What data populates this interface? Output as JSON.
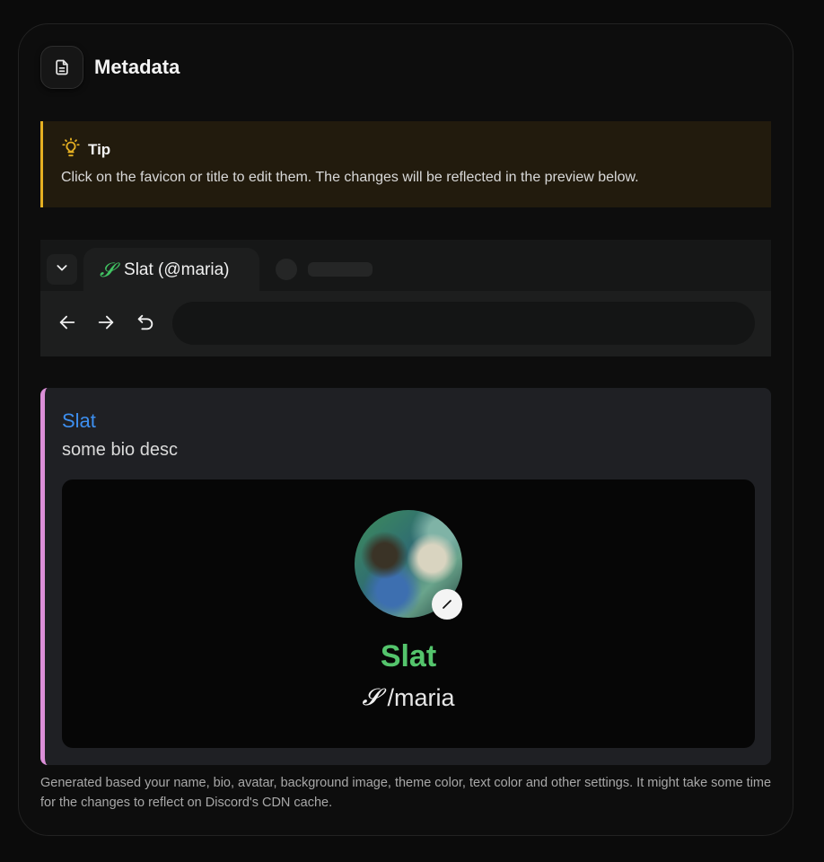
{
  "header": {
    "title": "Metadata",
    "icon": "document-icon"
  },
  "tip": {
    "title": "Tip",
    "icon": "lightbulb-icon",
    "text": "Click on the favicon or title to edit them. The changes will be reflected in the preview below.",
    "accent_color": "#e5b022"
  },
  "browser": {
    "tab": {
      "logo": "𝓢",
      "label": "Slat (@maria)",
      "logo_color": "#41c463"
    },
    "toggle_icon": "chevron-down-icon",
    "nav": {
      "back_icon": "arrow-left-icon",
      "forward_icon": "arrow-right-icon",
      "reload_icon": "reload-icon"
    },
    "url": ""
  },
  "embed": {
    "accent_color": "#db8fd8",
    "title": "Slat",
    "description": "some bio desc",
    "profile": {
      "name": "Slat",
      "handle_logo": "𝓢",
      "handle": "/maria",
      "name_color": "#54c46c",
      "badge_icon": "verified-badge-icon"
    }
  },
  "footnote": "Generated based your name, bio, avatar, background image, theme color, text color and other settings. It might take some time for the changes to reflect on Discord's CDN cache."
}
